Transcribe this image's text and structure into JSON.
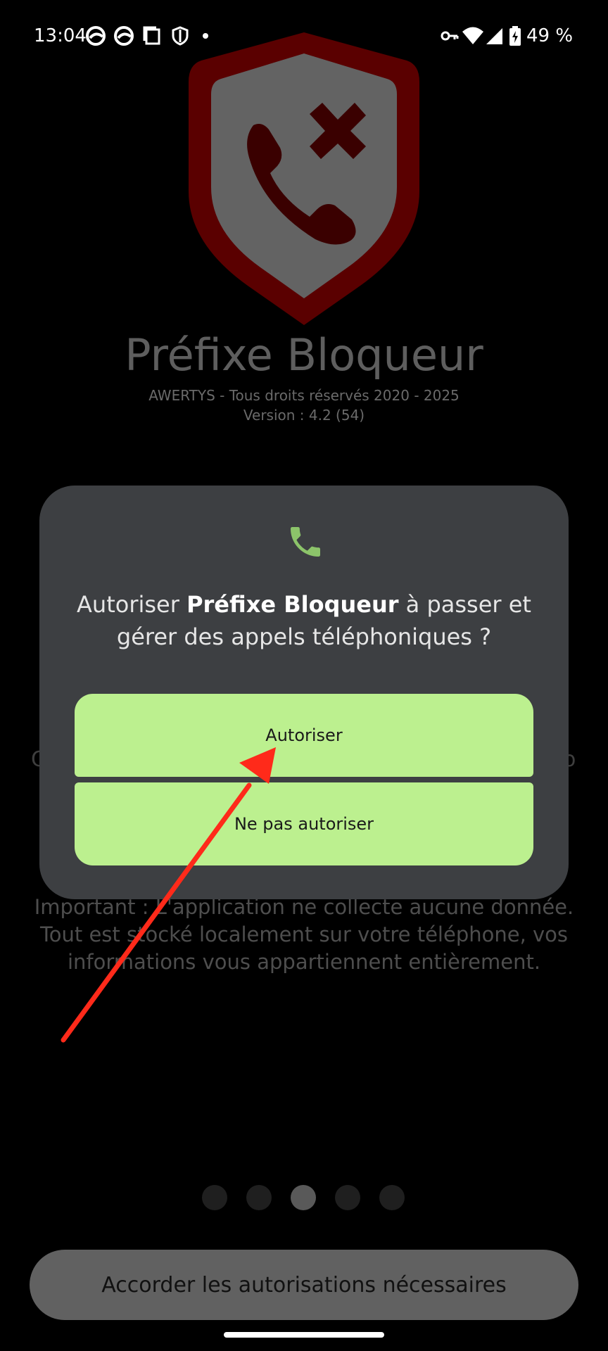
{
  "status_bar": {
    "time": "13:04",
    "battery": "49 %",
    "icons_left": [
      "edge-browser-icon",
      "edge-browser-icon",
      "screenshot-icon",
      "shield-icon",
      "dot-icon"
    ],
    "icons_right": [
      "vpn-key-icon",
      "wifi-icon",
      "cell-signal-icon",
      "battery-charging-icon"
    ]
  },
  "app": {
    "title": "Préfixe Bloqueur",
    "copyright": "AWERTYS - Tous droits réservés 2020 - 2025",
    "version": "Version : 4.2 (54)",
    "partial_left": "C",
    "partial_right": "o",
    "important": "Important : L'application ne collecte aucune donnée. Tout est stocké localement sur votre téléphone, vos informations vous appartiennent entièrement.",
    "grant_button": "Accorder les autorisations nécessaires",
    "pager": {
      "count": 5,
      "active_index": 2
    }
  },
  "dialog": {
    "icon": "phone-icon",
    "message_prefix": "Autoriser ",
    "message_app": "Préfixe Bloqueur",
    "message_suffix": " à passer et gérer des appels téléphoniques ?",
    "allow_button": "Autoriser",
    "deny_button": "Ne pas autoriser"
  },
  "colors": {
    "dialog_bg": "#3d3f42",
    "button_bg": "#bcf08f",
    "icon_green": "#8cc46a",
    "logo_red": "#5a0000",
    "arrow_red": "#ff2a1a"
  }
}
